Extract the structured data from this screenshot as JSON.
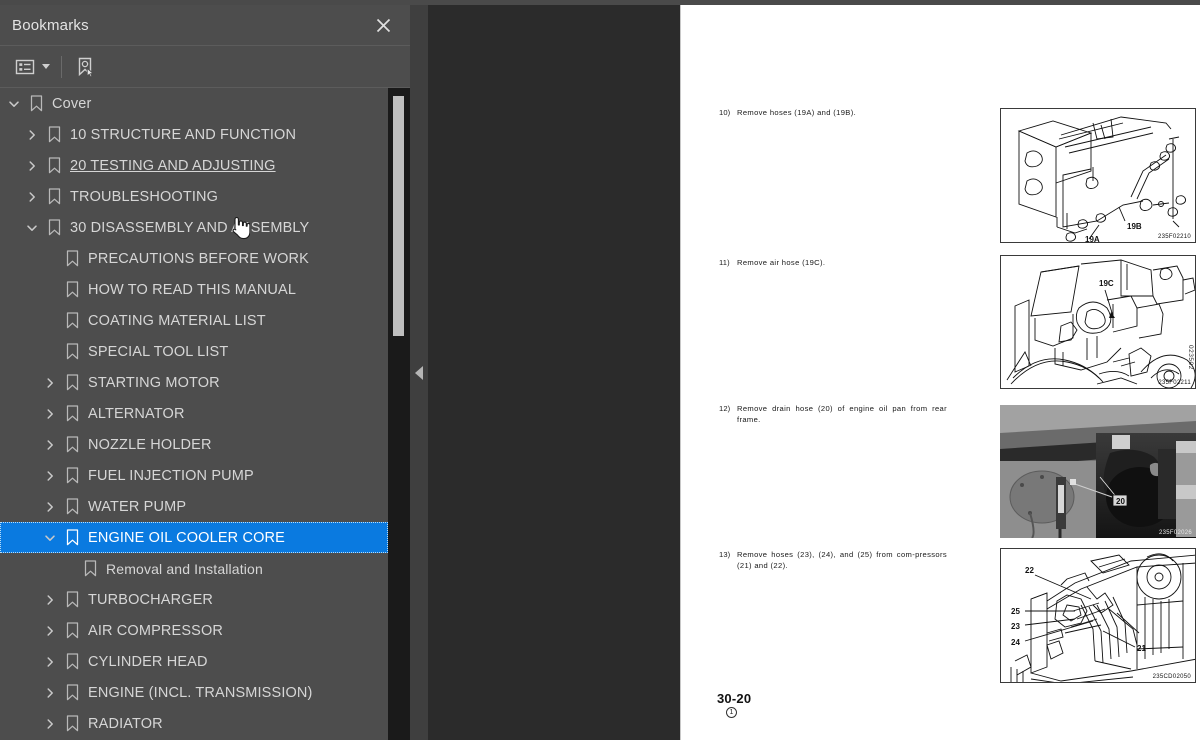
{
  "panel": {
    "title": "Bookmarks",
    "close_icon": "close-icon",
    "toolbar": {
      "options_icon": "list-options-icon",
      "options_caret": "chevron-down-icon",
      "new_bookmark_icon": "new-bookmark-icon"
    }
  },
  "splitter": {
    "collapse_icon": "collapse-left-arrow-icon"
  },
  "tree": {
    "selected_color": "#0a7ae0",
    "items": [
      {
        "label": "Cover",
        "level": 0,
        "state": "expanded",
        "selected": false,
        "hovered": false
      },
      {
        "label": "10 STRUCTURE AND FUNCTION",
        "level": 1,
        "state": "collapsed",
        "selected": false,
        "hovered": false
      },
      {
        "label": "20 TESTING AND ADJUSTING",
        "level": 1,
        "state": "collapsed",
        "selected": false,
        "hovered": true
      },
      {
        "label": "TROUBLESHOOTING",
        "level": 1,
        "state": "collapsed",
        "selected": false,
        "hovered": false
      },
      {
        "label": "30 DISASSEMBLY AND ASSEMBLY",
        "level": 1,
        "state": "expanded",
        "selected": false,
        "hovered": false
      },
      {
        "label": "PRECAUTIONS BEFORE WORK",
        "level": 2,
        "state": "leaf",
        "selected": false,
        "hovered": false
      },
      {
        "label": "HOW TO READ THIS MANUAL",
        "level": 2,
        "state": "leaf",
        "selected": false,
        "hovered": false
      },
      {
        "label": "COATING MATERIAL LIST",
        "level": 2,
        "state": "leaf",
        "selected": false,
        "hovered": false
      },
      {
        "label": "SPECIAL TOOL LIST",
        "level": 2,
        "state": "leaf",
        "selected": false,
        "hovered": false
      },
      {
        "label": "STARTING MOTOR",
        "level": 2,
        "state": "collapsed",
        "selected": false,
        "hovered": false
      },
      {
        "label": "ALTERNATOR",
        "level": 2,
        "state": "collapsed",
        "selected": false,
        "hovered": false
      },
      {
        "label": "NOZZLE HOLDER",
        "level": 2,
        "state": "collapsed",
        "selected": false,
        "hovered": false
      },
      {
        "label": "FUEL INJECTION PUMP",
        "level": 2,
        "state": "collapsed",
        "selected": false,
        "hovered": false
      },
      {
        "label": "WATER PUMP",
        "level": 2,
        "state": "collapsed",
        "selected": false,
        "hovered": false
      },
      {
        "label": "ENGINE OIL COOLER CORE",
        "level": 2,
        "state": "expanded",
        "selected": true,
        "hovered": false
      },
      {
        "label": "Removal and Installation",
        "level": 3,
        "state": "leaf",
        "selected": false,
        "hovered": false
      },
      {
        "label": "TURBOCHARGER",
        "level": 2,
        "state": "collapsed",
        "selected": false,
        "hovered": false
      },
      {
        "label": "AIR COMPRESSOR",
        "level": 2,
        "state": "collapsed",
        "selected": false,
        "hovered": false
      },
      {
        "label": "CYLINDER HEAD",
        "level": 2,
        "state": "collapsed",
        "selected": false,
        "hovered": false
      },
      {
        "label": "ENGINE (INCL. TRANSMISSION)",
        "level": 2,
        "state": "collapsed",
        "selected": false,
        "hovered": false
      },
      {
        "label": "RADIATOR",
        "level": 2,
        "state": "collapsed",
        "selected": false,
        "hovered": false
      }
    ]
  },
  "document": {
    "steps": [
      {
        "num": "10)",
        "text": "Remove hoses (19A) and (19B).",
        "fig_code": "235F02210",
        "fig_labels": [
          "19A",
          "19B"
        ]
      },
      {
        "num": "11)",
        "text": "Remove air hose (19C).",
        "fig_code": "235F02211",
        "fig_labels": [
          "19C"
        ]
      },
      {
        "num": "12)",
        "text": "Remove drain hose (20) of engine oil pan from rear frame.",
        "fig_code": "235F02026",
        "fig_labels": [
          "20"
        ]
      },
      {
        "num": "13)",
        "text": "Remove hoses (23), (24), and (25) from com-pressors (21) and (22).",
        "fig_code": "235CD02050",
        "fig_labels": [
          "22",
          "25",
          "23",
          "24",
          "21"
        ]
      }
    ],
    "side_code": "023502",
    "page_number": "30-20",
    "page_marker": "1"
  }
}
